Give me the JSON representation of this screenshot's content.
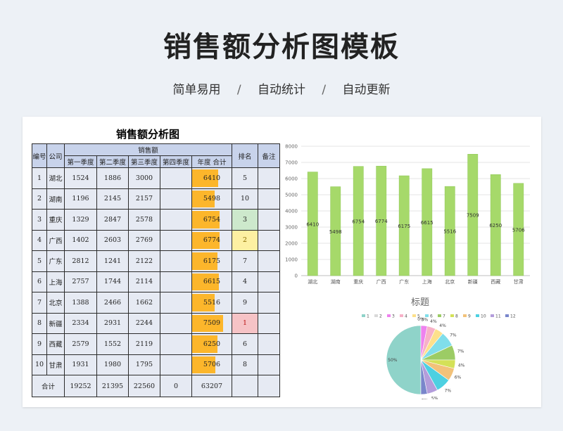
{
  "hero": {
    "title": "销售额分析图模板",
    "subtitle": [
      "简单易用",
      "自动统计",
      "自动更新"
    ],
    "separator": "/"
  },
  "sheet": {
    "title": "销售额分析图",
    "headers": {
      "no": "编号",
      "company": "公司",
      "sales": "销售额",
      "q1": "第一季度",
      "q2": "第二季度",
      "q3": "第三季度",
      "q4": "第四季度",
      "total": "年度 合计",
      "rank": "排名",
      "note": "备注"
    },
    "rows": [
      {
        "no": "1",
        "company": "湖北",
        "q1": "1524",
        "q2": "1886",
        "q3": "3000",
        "q4": "",
        "total": "6410",
        "rank": "5"
      },
      {
        "no": "2",
        "company": "湖南",
        "q1": "1196",
        "q2": "2145",
        "q3": "2157",
        "q4": "",
        "total": "5498",
        "rank": "10"
      },
      {
        "no": "3",
        "company": "重庆",
        "q1": "1329",
        "q2": "2847",
        "q3": "2578",
        "q4": "",
        "total": "6754",
        "rank": "3"
      },
      {
        "no": "4",
        "company": "广西",
        "q1": "1402",
        "q2": "2603",
        "q3": "2769",
        "q4": "",
        "total": "6774",
        "rank": "2"
      },
      {
        "no": "5",
        "company": "广东",
        "q1": "2812",
        "q2": "1241",
        "q3": "2122",
        "q4": "",
        "total": "6175",
        "rank": "7"
      },
      {
        "no": "6",
        "company": "上海",
        "q1": "2757",
        "q2": "1744",
        "q3": "2114",
        "q4": "",
        "total": "6615",
        "rank": "4"
      },
      {
        "no": "7",
        "company": "北京",
        "q1": "1388",
        "q2": "2466",
        "q3": "1662",
        "q4": "",
        "total": "5516",
        "rank": "9"
      },
      {
        "no": "8",
        "company": "新疆",
        "q1": "2334",
        "q2": "2931",
        "q3": "2244",
        "q4": "",
        "total": "7509",
        "rank": "1"
      },
      {
        "no": "9",
        "company": "西藏",
        "q1": "2579",
        "q2": "1552",
        "q3": "2119",
        "q4": "",
        "total": "6250",
        "rank": "6"
      },
      {
        "no": "10",
        "company": "甘肃",
        "q1": "1931",
        "q2": "1980",
        "q3": "1795",
        "q4": "",
        "total": "5706",
        "rank": "8"
      }
    ],
    "totals": {
      "label": "合计",
      "q1": "19252",
      "q2": "21395",
      "q3": "22560",
      "q4": "0",
      "total": "63207"
    },
    "colors": {
      "total_bar": "#fcb62b",
      "rank1": "#f6c3c6",
      "rank2": "#fdf0a2",
      "rank3": "#cde9cc",
      "header": "#c8d3eb"
    }
  },
  "chart_data": [
    {
      "type": "bar",
      "categories": [
        "湖北",
        "湖南",
        "重庆",
        "广西",
        "广东",
        "上海",
        "北京",
        "新疆",
        "西藏",
        "甘肃"
      ],
      "values": [
        6410,
        5498,
        6754,
        6774,
        6175,
        6615,
        5516,
        7509,
        6250,
        5706
      ],
      "y_ticks": [
        "0",
        "1000",
        "2000",
        "3000",
        "4000",
        "5000",
        "6000",
        "7000",
        "8000"
      ],
      "ylim": [
        0,
        8000
      ],
      "color": "#a6d96a",
      "grid": true
    },
    {
      "type": "pie",
      "title": "标题",
      "legend_labels": [
        "1",
        "2",
        "3",
        "4",
        "5",
        "6",
        "7",
        "8",
        "9",
        "10",
        "11",
        "12"
      ],
      "values": [
        50,
        0,
        3,
        4,
        4,
        7,
        7,
        4,
        6,
        7,
        5,
        3
      ],
      "value_labels": [
        "50%",
        "0%",
        "3%",
        "4%",
        "4%",
        "7%",
        "7%",
        "4%",
        "6%",
        "7%",
        "5%",
        "3%"
      ],
      "colors": [
        "#8fd3c9",
        "#d9d9d9",
        "#ee82ee",
        "#f7b1c8",
        "#fde08b",
        "#80deea",
        "#9ccc65",
        "#d4e157",
        "#f2c27a",
        "#4dd0e1",
        "#b39ddb",
        "#7986cb"
      ]
    }
  ]
}
